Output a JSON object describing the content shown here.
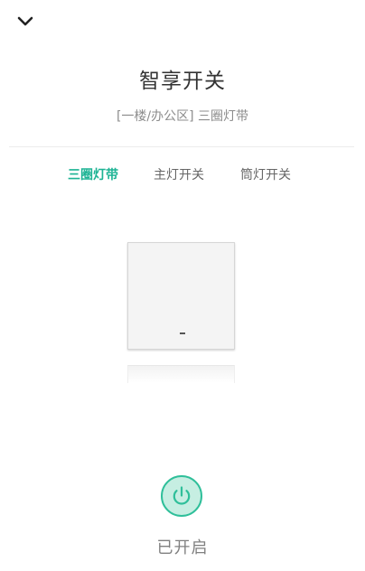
{
  "header": {
    "back_icon": "chevron-down-icon",
    "title": "智享开关",
    "subtitle": "[一楼/办公区] 三圈灯带"
  },
  "tabs": [
    {
      "label": "三圈灯带",
      "active": true
    },
    {
      "label": "主灯开关",
      "active": false
    },
    {
      "label": "筒灯开关",
      "active": false
    }
  ],
  "switch": {
    "state": "on"
  },
  "power": {
    "icon": "power-icon",
    "status_label": "已开启"
  },
  "colors": {
    "accent": "#1db394",
    "power_fill": "#c6eee2",
    "power_stroke": "#2fbf9a"
  }
}
